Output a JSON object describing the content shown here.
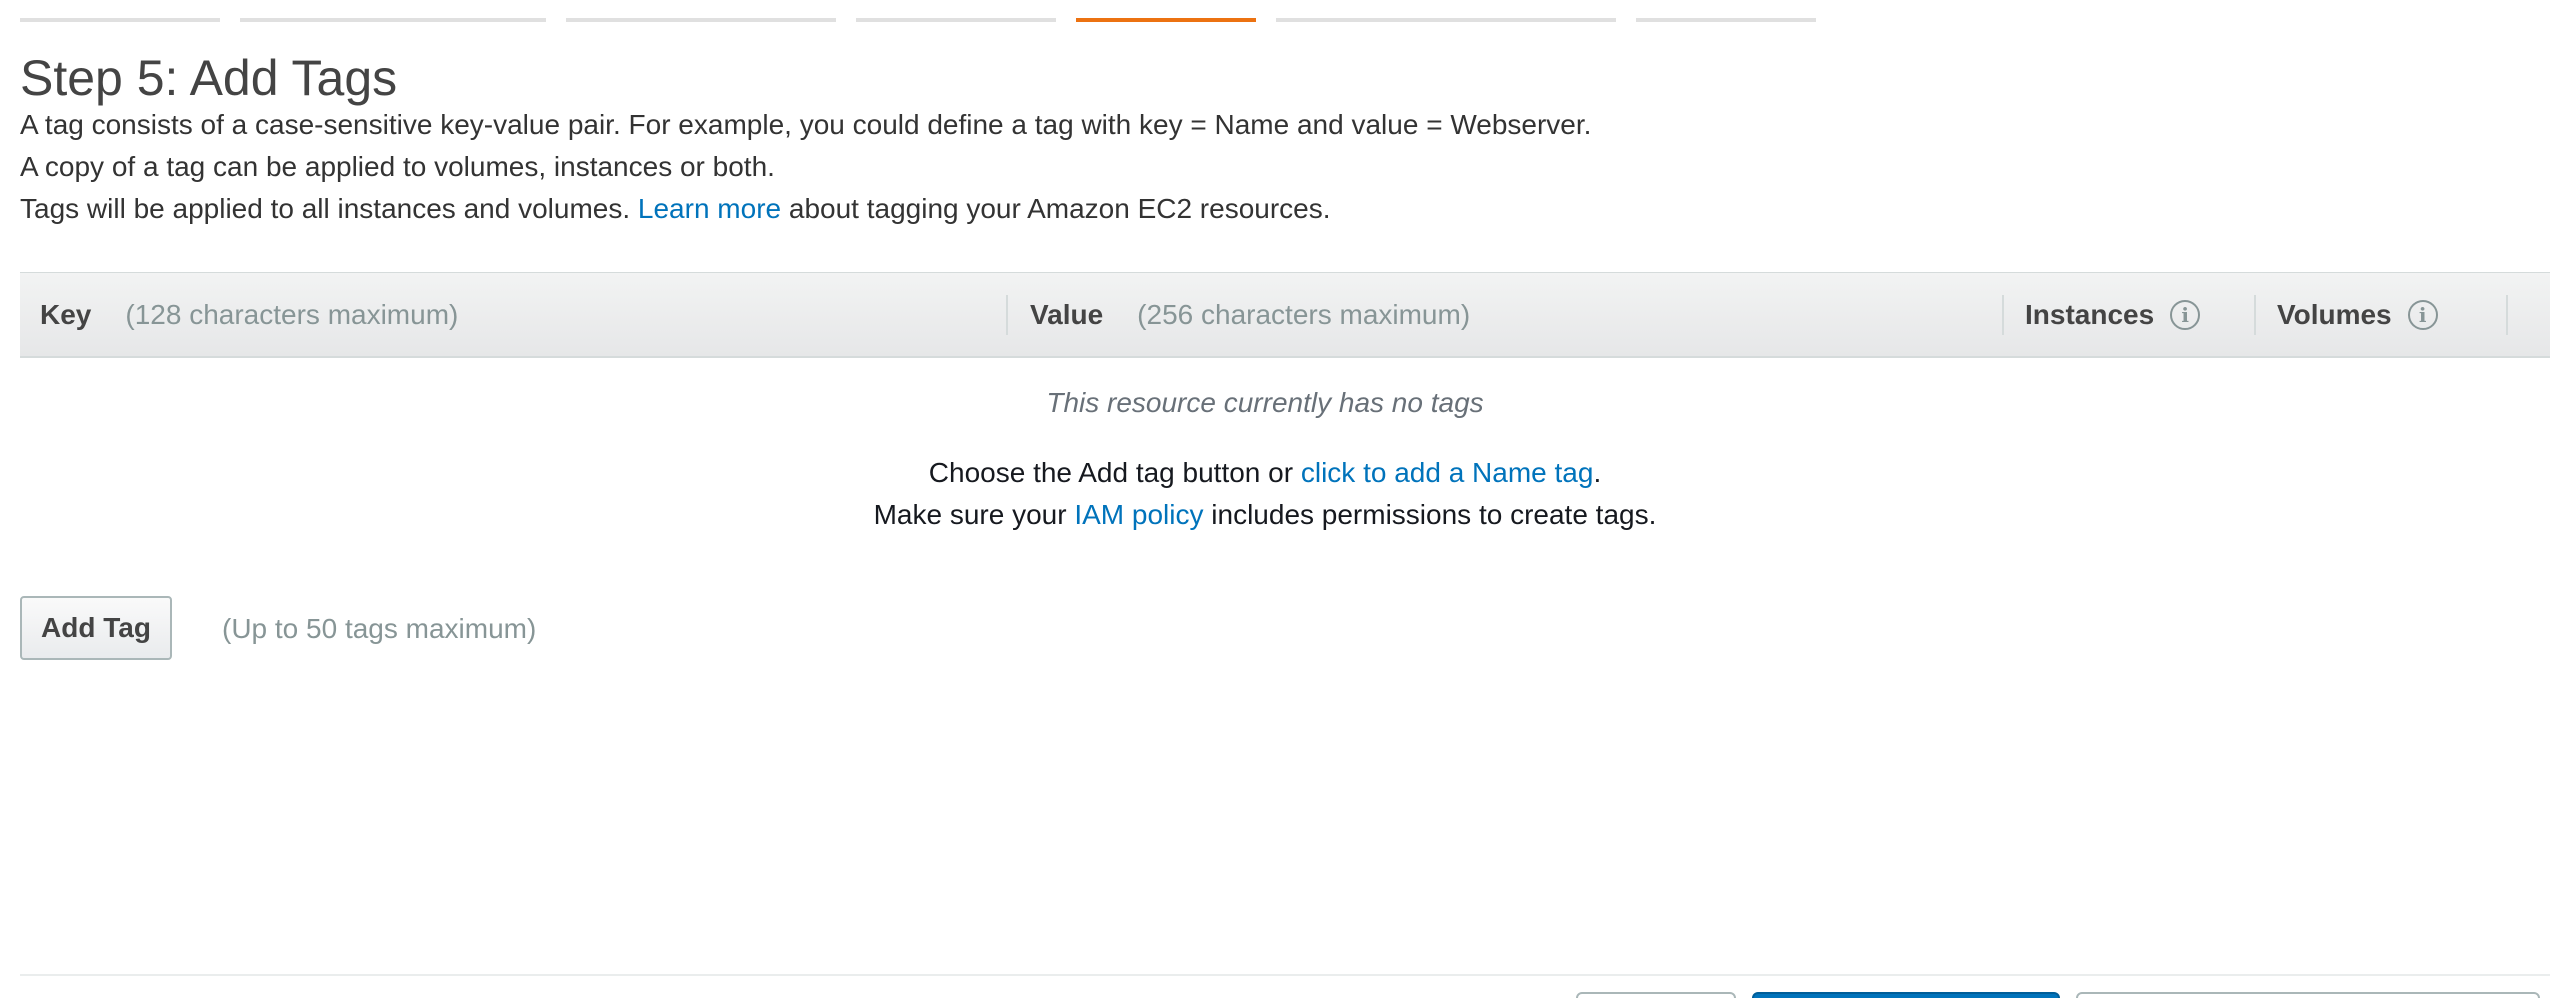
{
  "wizard": {
    "active_tab": "5. Add Tags"
  },
  "header": {
    "title": "Step 5: Add Tags",
    "desc_line1": "A tag consists of a case-sensitive key-value pair. For example, you could define a tag with key = Name and value = Webserver.",
    "desc_line2": "A copy of a tag can be applied to volumes, instances or both.",
    "desc_line3_before": "Tags will be applied to all instances and volumes.",
    "desc_line3_link": "Learn more",
    "desc_line3_after": "about tagging your Amazon EC2 resources."
  },
  "table": {
    "columns": {
      "key": {
        "label": "Key",
        "hint": "(128 characters maximum)"
      },
      "value": {
        "label": "Value",
        "hint": "(256 characters maximum)"
      },
      "instances": {
        "label": "Instances",
        "info_icon": "info-icon"
      },
      "volumes": {
        "label": "Volumes",
        "info_icon": "info-icon"
      }
    },
    "empty": {
      "title": "This resource currently has no tags",
      "line1_before": "Choose the Add tag button or",
      "line1_link": "click to add a Name tag",
      "line1_after": ".",
      "line2_before": "Make sure your",
      "line2_link": "IAM policy",
      "line2_after": "includes permissions to create tags."
    }
  },
  "actions": {
    "add_tag_label": "Add Tag",
    "add_tag_hint": "(Up to 50 tags maximum)"
  },
  "colors": {
    "link": "#0073bb",
    "active_tab_accent": "#ec7211",
    "primary_button": "#0073bb"
  }
}
